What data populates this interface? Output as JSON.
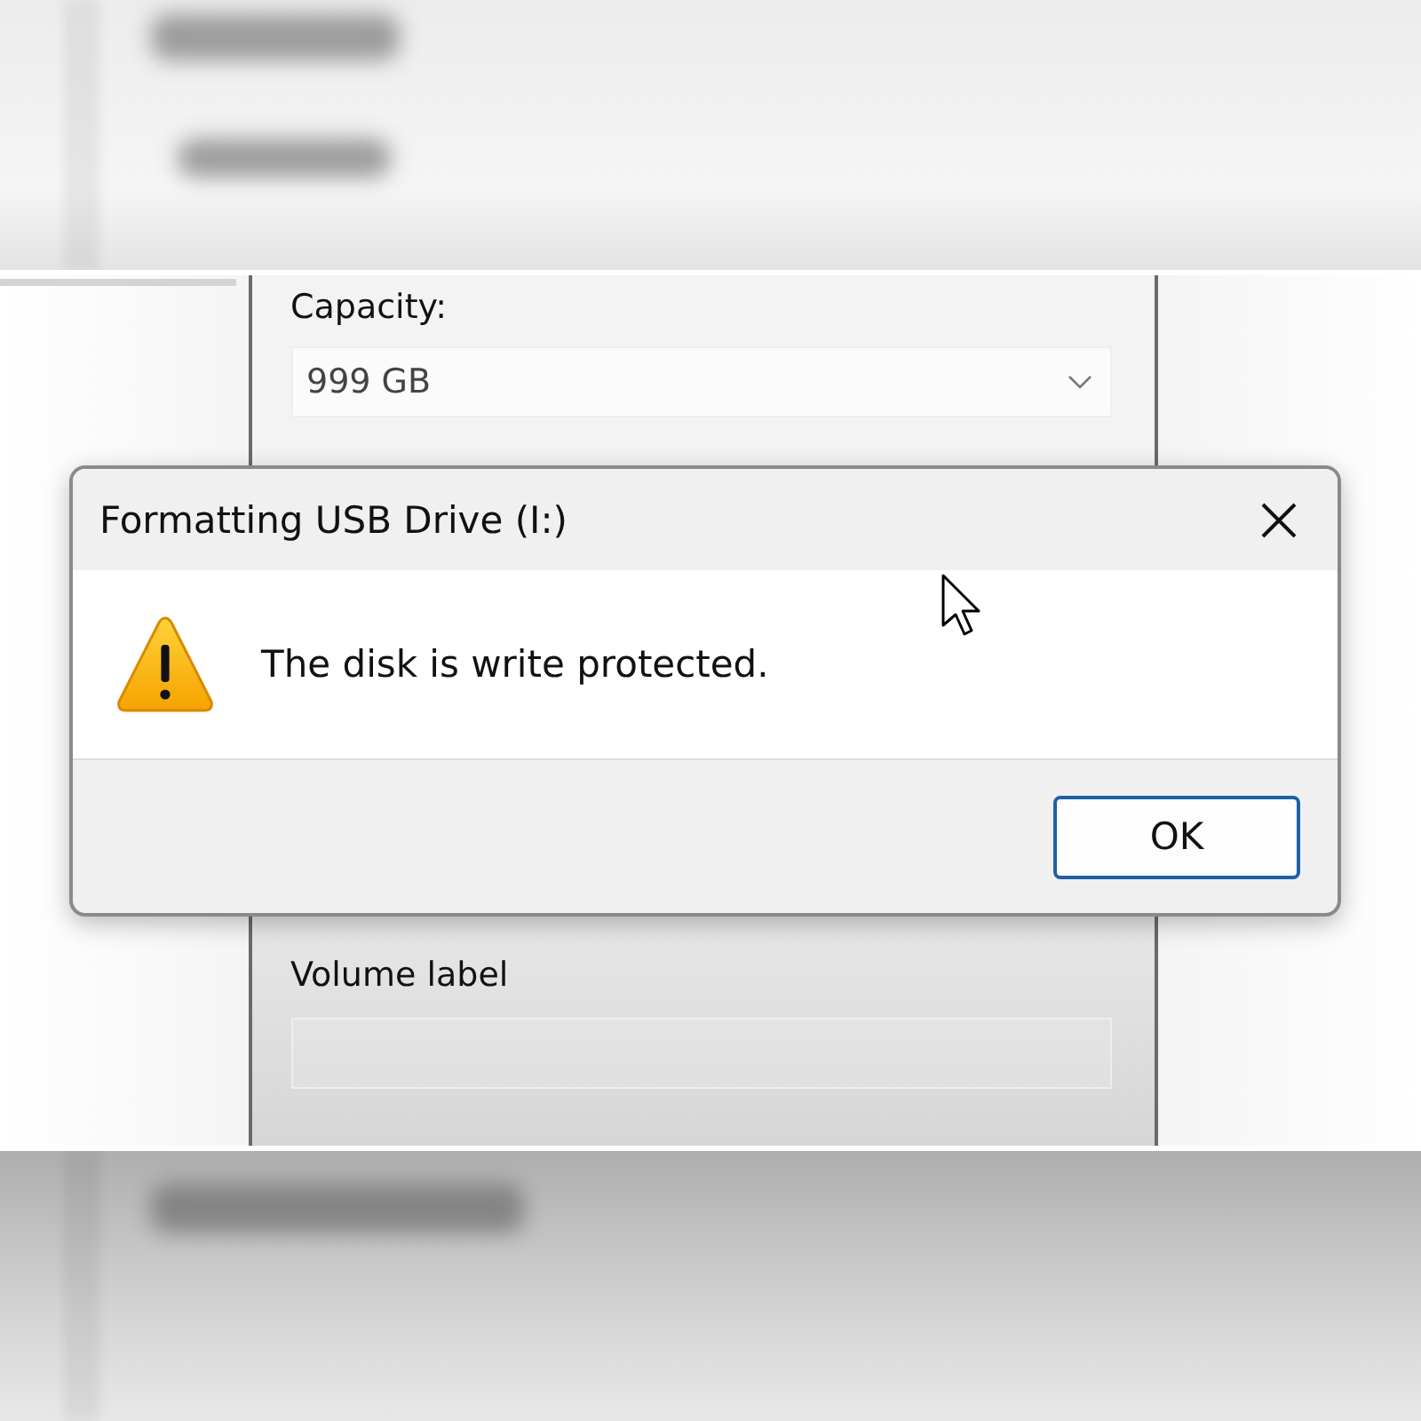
{
  "format_panel": {
    "capacity_label": "Capacity:",
    "capacity_value": "999 GB",
    "volume_label": "Volume label"
  },
  "dialog": {
    "title": "Formatting USB Drive (I:)",
    "message": "The disk is write protected.",
    "buttons": [
      "OK"
    ]
  }
}
